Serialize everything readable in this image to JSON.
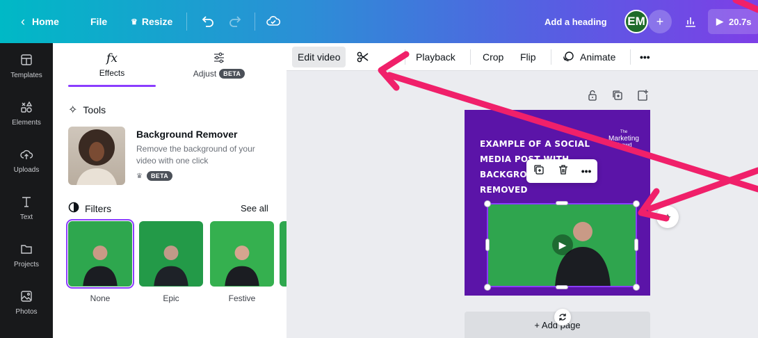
{
  "topbar": {
    "home": "Home",
    "file": "File",
    "resize": "Resize",
    "heading": "Add a heading",
    "avatar_initials": "EM",
    "share_plus": "+",
    "duration": "20.7s",
    "bg_gradient": [
      "#00b9c6",
      "#7d3fe6"
    ]
  },
  "rail": {
    "items": [
      {
        "label": "Templates",
        "icon": "templates-icon"
      },
      {
        "label": "Elements",
        "icon": "elements-icon"
      },
      {
        "label": "Uploads",
        "icon": "uploads-icon"
      },
      {
        "label": "Text",
        "icon": "text-icon"
      },
      {
        "label": "Projects",
        "icon": "folder-icon"
      },
      {
        "label": "Photos",
        "icon": "photos-icon"
      }
    ]
  },
  "panel": {
    "tabs": [
      {
        "label": "Effects",
        "icon_text": "fx"
      },
      {
        "label": "Adjust",
        "badge": "BETA"
      }
    ],
    "tools_title": "Tools",
    "tool": {
      "title": "Background Remover",
      "description": "Remove the background of your video with one click",
      "badge": "BETA"
    },
    "filters_title": "Filters",
    "see_all": "See all",
    "filters": [
      {
        "label": "None",
        "selected": true
      },
      {
        "label": "Epic",
        "selected": false
      },
      {
        "label": "Festive",
        "selected": false
      }
    ]
  },
  "toolbar": {
    "edit_video": "Edit video",
    "playback": "Playback",
    "crop": "Crop",
    "flip": "Flip",
    "animate": "Animate",
    "more": "•••"
  },
  "design": {
    "headline": "Example of a social media post with background removed",
    "brand_small": "The",
    "brand_name": "Marketing",
    "brand_sub": "Crowd",
    "background_color": "#5b14a8",
    "video_bg_color": "#2fa54e"
  },
  "canvas": {
    "add_page": "+ Add page",
    "float_more": "•••"
  },
  "colors": {
    "accent": "#8b3dff",
    "annotation": "#f0206a"
  }
}
